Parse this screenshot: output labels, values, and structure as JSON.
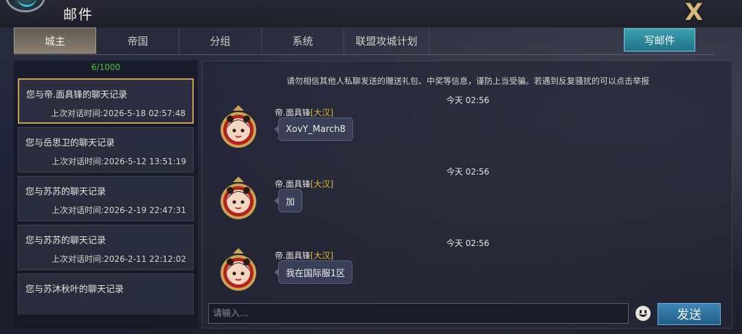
{
  "header": {
    "title": "邮件",
    "close_label": "X"
  },
  "tabs": [
    {
      "label": "城主",
      "active": true
    },
    {
      "label": "帝国"
    },
    {
      "label": "分组"
    },
    {
      "label": "系统"
    },
    {
      "label": "联盟攻城计划"
    }
  ],
  "compose_label": "写邮件",
  "conversations": {
    "count": "6/1000",
    "items": [
      {
        "title": "您与帝.面具锋的聊天记录",
        "last_time": "上次对话时间:2026-5-18   02:57:48",
        "selected": true
      },
      {
        "title": "您与岳思卫的聊天记录",
        "last_time": "上次对话时间:2026-5-12   13:51:19"
      },
      {
        "title": "您与苏苏的聊天记录",
        "last_time": "上次对话时间:2026-2-19   22:47:31"
      },
      {
        "title": "您与苏苏的聊天记录",
        "last_time": "上次对话时间:2026-2-11   22:12:02"
      },
      {
        "title": "您与苏沐秋叶的聊天记录",
        "last_time": ""
      }
    ]
  },
  "chat": {
    "notice": "请勿相信其他人私聊发送的赠送礼包、中奖等信息，谨防上当受骗。若遇到反复骚扰的可以点击举报",
    "messages": [
      {
        "timestamp": "今天 02:56",
        "sender": "帝.面具锋",
        "nation": "[大汉]",
        "text": "XovY_March8"
      },
      {
        "timestamp": "今天 02:56",
        "sender": "帝.面具锋",
        "nation": "[大汉]",
        "text": "加"
      },
      {
        "timestamp": "今天 02:56",
        "sender": "帝.面具锋",
        "nation": "[大汉]",
        "text": "我在国际服1区"
      }
    ],
    "input_placeholder": "请输入…",
    "send_label": "发送"
  },
  "colors": {
    "accent_gold": "#c9a453",
    "count_green": "#4fc03a",
    "nation_yellow": "#e6b93a",
    "send_blue": "#3e86b6"
  }
}
